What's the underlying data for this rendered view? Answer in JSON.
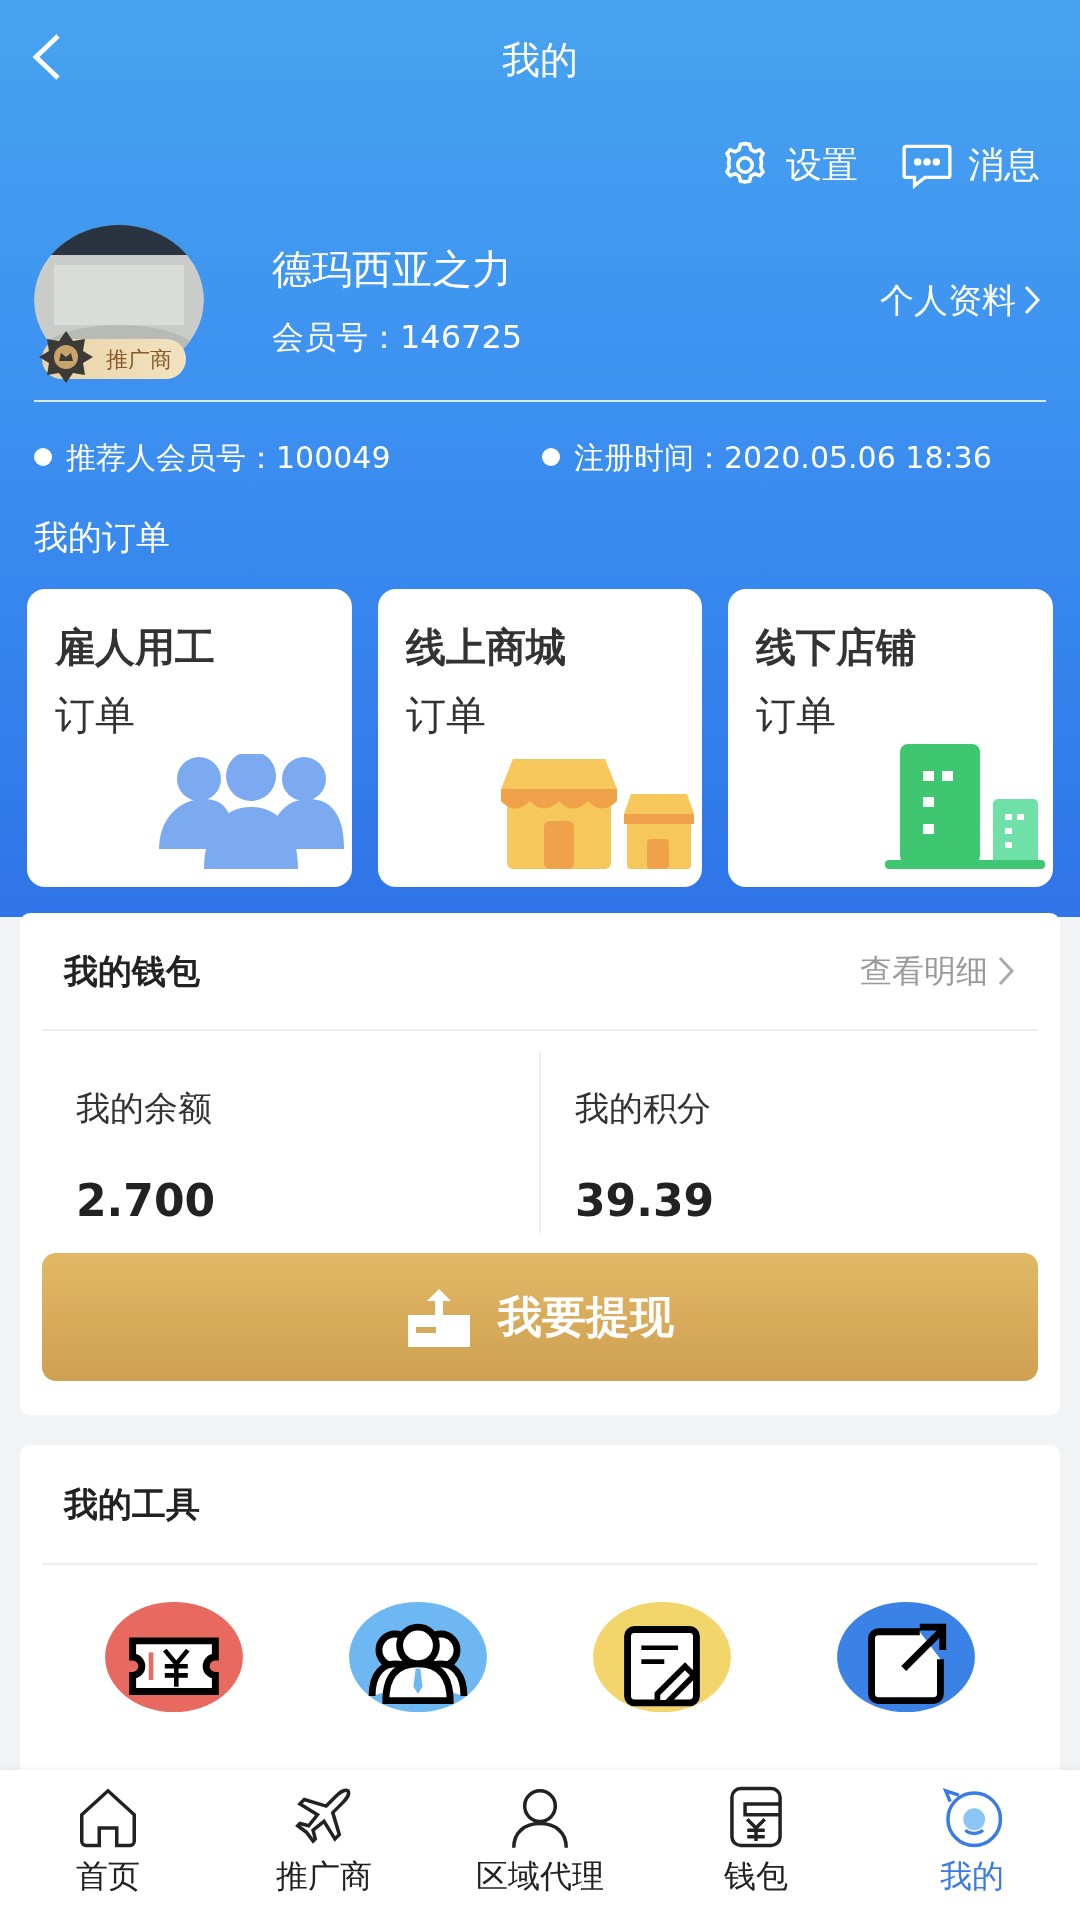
{
  "header": {
    "title": "我的",
    "actions": [
      {
        "kind": "settings",
        "label": "设置"
      },
      {
        "kind": "messages",
        "label": "消息"
      }
    ]
  },
  "profile": {
    "badge": "推广商",
    "name": "德玛西亚之力",
    "member_no": "会员号：146725",
    "profile_link": "个人资料"
  },
  "info": [
    {
      "label": "推荐人会员号：100049"
    },
    {
      "label": "注册时间：2020.05.06 18:36"
    }
  ],
  "orders": {
    "title": "我的订单",
    "cards": [
      {
        "kind": "people",
        "title": "雇人用工",
        "subtitle": "订单"
      },
      {
        "kind": "shops",
        "title": "线上商城",
        "subtitle": "订单"
      },
      {
        "kind": "buildings",
        "title": "线下店铺",
        "subtitle": "订单"
      }
    ]
  },
  "wallet": {
    "title": "我的钱包",
    "detail_link": "查看明细",
    "stats": [
      {
        "label": "我的余额",
        "value": "2.700"
      },
      {
        "label": "我的积分",
        "value": "39.39"
      }
    ],
    "withdraw_button": "我要提现"
  },
  "tools": {
    "title": "我的工具",
    "items": [
      {
        "kind": "ticket",
        "color": "#e8695f"
      },
      {
        "kind": "team",
        "color": "#6db8f2"
      },
      {
        "kind": "note",
        "color": "#f2d56b"
      },
      {
        "kind": "share",
        "color": "#3b82e6"
      }
    ]
  },
  "tab_bar": [
    {
      "kind": "home",
      "label": "首页",
      "selected": false
    },
    {
      "kind": "plane",
      "label": "推广商",
      "selected": false
    },
    {
      "kind": "person",
      "label": "区域代理",
      "selected": false
    },
    {
      "kind": "wallet",
      "label": "钱包",
      "selected": false
    },
    {
      "kind": "mine",
      "label": "我的",
      "selected": true
    }
  ]
}
